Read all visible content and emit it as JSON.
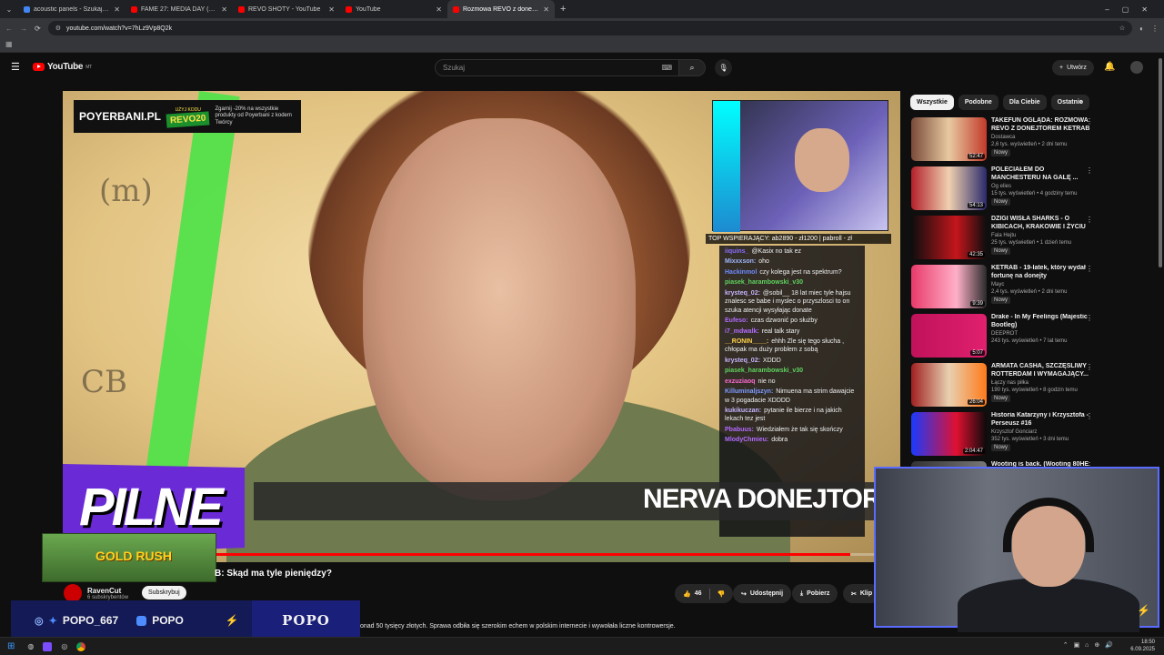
{
  "browser": {
    "tabs": [
      {
        "title": "acoustic panels - Szukaj w Goo",
        "fav": "#4285f4",
        "active": false
      },
      {
        "title": "FAME 27: MEDIA DAY (Media tr",
        "fav": "#ff0000",
        "active": false
      },
      {
        "title": "REVO SHOTY - YouTube",
        "fav": "#ff0000",
        "active": false
      },
      {
        "title": "YouTube",
        "fav": "#ff0000",
        "active": false
      },
      {
        "title": "Rozmowa REVO z donejtor",
        "fav": "#ff0000",
        "active": true
      }
    ],
    "url": "youtube.com/watch?v=7hLz9Vp8Q2k"
  },
  "youtube": {
    "logo_text": "YouTube",
    "logo_region": "MT",
    "search_placeholder": "Szukaj",
    "create_label": "Utwórz"
  },
  "video": {
    "promo_brand": "POYERBANI.PL",
    "promo_code": "REVO20",
    "promo_tag": "UŻYJ KODU",
    "promo_text": "Zgarnij -20% na wszystkie produkty od Poyerbani z kodem Twórcy",
    "top_supporters": "TOP WSPIERAJĄCY: ab2890 - zł1200 | pabroll - zł",
    "breaking_label": "PILNE",
    "ticker_text": "NERVA DONEJTOR",
    "progress": 0.94,
    "chat": [
      {
        "user": "iiquins_",
        "text": "@Kasix no tak ez",
        "color": "#8a6cff"
      },
      {
        "user": "Mixxxson:",
        "text": "oho",
        "color": "#9fb6ff"
      },
      {
        "user": "Hackinmol",
        "text": "czy kolega jest na spektrum?",
        "color": "#6f8bff"
      },
      {
        "user": "piasek_harambowski_v30",
        "text": "",
        "color": "#5fd35f"
      },
      {
        "user": "krysteq_02:",
        "text": "@sobil__ 18 lat miec tyle hajsu znalesc se babe i myslec o przyszlosci to on szuka atencji wysyłając donate",
        "color": "#c7b5ff"
      },
      {
        "user": "Eufeso:",
        "text": "czas dzwonić po służby",
        "color": "#b36bff"
      },
      {
        "user": "i7_mdwalk:",
        "text": "real talk stary",
        "color": "#b36bff"
      },
      {
        "user": "__RONIN____:",
        "text": "ehhh Zle się tego słucha , chłopak ma duży problem z sobą",
        "color": "#ffd24d"
      },
      {
        "user": "krysteq_02:",
        "text": "XDDD",
        "color": "#c7b5ff"
      },
      {
        "user": "piasek_harambowski_v30",
        "text": "",
        "color": "#5fd35f"
      },
      {
        "user": "exzuziaoq",
        "text": "nie no",
        "color": "#ff6ad5"
      },
      {
        "user": "Killuminaljszyn:",
        "text": "Nimuena ma strim dawajcie w 3 pogadacie XDDDD",
        "color": "#7d9bff"
      },
      {
        "user": "kukikuczan:",
        "text": "pytanie ile bierze i na jakich lekach tez jest",
        "color": "#c7b5ff"
      },
      {
        "user": "Pbabuus:",
        "text": "Wiedziałem że tak się skończy",
        "color": "#b36bff"
      },
      {
        "user": "MlodyChmieu:",
        "text": "dobra",
        "color": "#b36bff"
      }
    ],
    "goldrush_label": "GOLD RUSH",
    "title_visible": "B: Skąd ma tyle pieniędzy?",
    "channel_name": "RavenCut",
    "channel_subs": "6 subskrybentów",
    "subscribe_label": "Subskrybuj",
    "likes": "46",
    "share_label": "Udostępnij",
    "download_label": "Pobierz",
    "clip_label": "Klip",
    "description": "onad 50 tysięcy złotych. Sprawa odbiła się szerokim echem w polskim internecie i wywołała liczne kontrowersje."
  },
  "overlay": {
    "handle": "POPO_667",
    "yt_name": "POPO",
    "brand": "POPO"
  },
  "sidebar": {
    "chips": [
      "Wszystkie",
      "Podobne",
      "Dla Ciebie",
      "Ostatnio"
    ],
    "recs": [
      {
        "title": "TAKEFUN OGLĄDA: ROZMOWA REVO Z DONEJTOREM KETRAB",
        "channel": "Dostawca",
        "meta": "2,6 tys. wyświetleń • 2 dni temu",
        "new": "Nowy",
        "dur": "52:47",
        "thumb": "linear-gradient(90deg,#7a4a3a,#e8c9a0 50%,#c23a2a)"
      },
      {
        "title": "POLECIAŁEM DO MANCHESTERU NA GALĘ ...",
        "channel": "Og elies",
        "meta": "15 tys. wyświetleń • 4 godziny temu",
        "new": "Nowy",
        "dur": "54:13",
        "thumb": "linear-gradient(90deg,#b3202a,#f0d0b0 50%,#2a2a6a)"
      },
      {
        "title": "DZIGI WISŁA SHARKS - O KIBICACH, KRAKOWIE I ŻYCIU",
        "channel": "Fala Hejtu",
        "meta": "25 tys. wyświetleń • 1 dzień temu",
        "new": "Nowy",
        "dur": "42:35",
        "thumb": "linear-gradient(90deg,#0d0d0d,#c4161c 60%,#0d0d0d)"
      },
      {
        "title": "KETRAB - 19-latek, który wydał fortunę na donejty",
        "channel": "Mayc",
        "meta": "2,4 tys. wyświetleń • 2 dni temu",
        "new": "Nowy",
        "dur": "9:39",
        "thumb": "linear-gradient(90deg,#e83a6a,#ffb0c8 60%,#2a2a2a)"
      },
      {
        "title": "Drake - In My Feelings (Majestic Bootleg)",
        "channel": "DEEPROT",
        "meta": "243 tys. wyświetleń • 7 lat temu",
        "new": "",
        "dur": "5:07",
        "thumb": "linear-gradient(90deg,#c0125a,#e0206e)"
      },
      {
        "title": "ARMATA CASHA, SZCZĘŚLIWY ROTTERDAM I WYMAGAJĄCY...",
        "channel": "Łączy nas piłka",
        "meta": "190 tys. wyświetleń • 8 godzin temu",
        "new": "Nowy",
        "dur": "26:04",
        "thumb": "linear-gradient(90deg,#a02020,#e8d0b0 50%,#ff7a1a)"
      },
      {
        "title": "Historia Katarzyny i Krzysztofa - Perseusz #16",
        "channel": "Krzysztof Gonciarz",
        "meta": "352 tys. wyświetleń • 3 dni temu",
        "new": "Nowy",
        "dur": "2:04:47",
        "thumb": "linear-gradient(90deg,#1a3aff,#e01030 60%,#0a0a0a)"
      },
      {
        "title": "Wooting is back. (Wooting 80HE",
        "channel": "",
        "meta": "",
        "new": "",
        "dur": "",
        "thumb": "linear-gradient(90deg,#333,#777)"
      }
    ]
  },
  "taskbar": {
    "time": "18:50",
    "date": "6.09.2025"
  },
  "colors": {
    "accent": "#ff0000",
    "overlay_blue": "#1a1f7a",
    "pilne_purple": "#6a2ad6"
  }
}
